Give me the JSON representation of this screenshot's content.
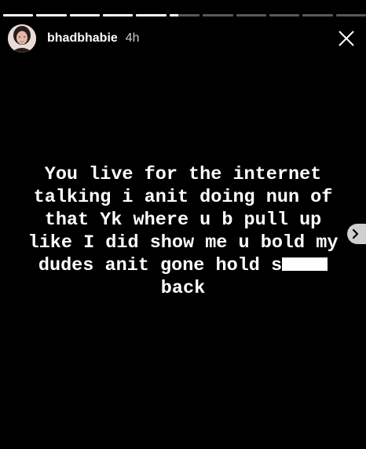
{
  "story": {
    "username": "bhadbhabie",
    "time_ago": "4h",
    "segments": [
      1,
      1,
      1,
      1,
      1,
      0.3,
      0,
      0,
      0,
      0,
      0
    ],
    "text_lines": [
      "You live for the internet",
      "talking i anit doing nun of",
      "that Yk where u b pull up",
      "like I did show me u bold my",
      "dudes anit gone hold s",
      "back"
    ]
  },
  "icons": {
    "close": "close-icon",
    "next": "chevron-right-icon",
    "avatar": "profile-picture"
  },
  "colors": {
    "background": "#000000",
    "text": "#ffffff",
    "progress_track": "rgba(255,255,255,0.35)",
    "progress_fill": "#ffffff"
  }
}
